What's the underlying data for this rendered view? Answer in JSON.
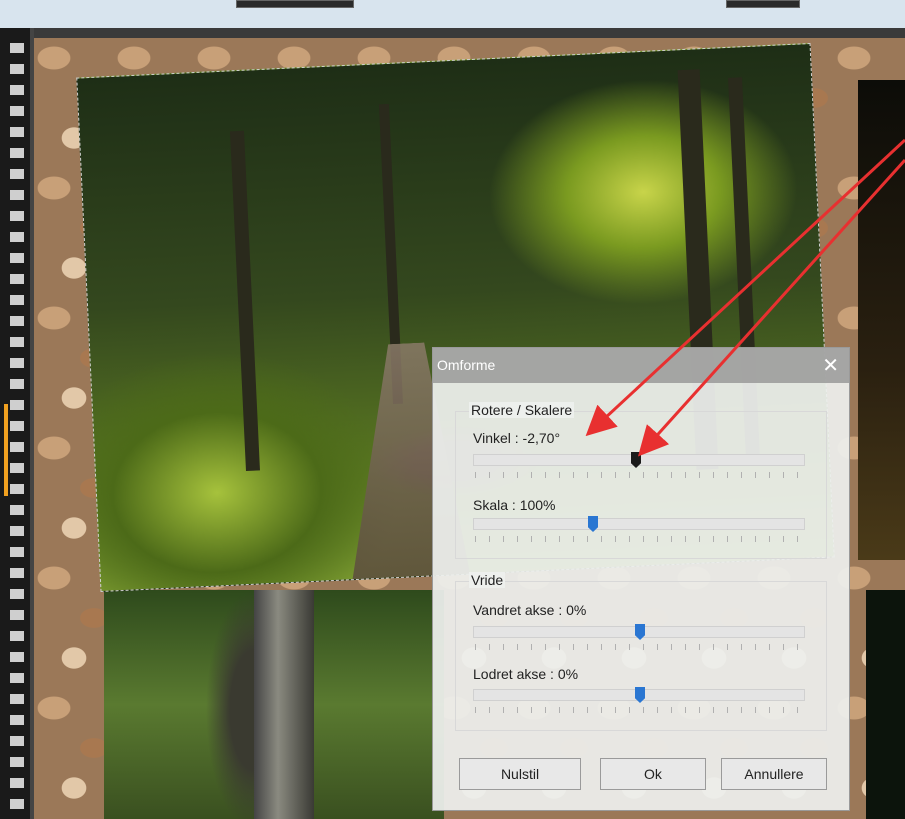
{
  "dialog": {
    "title": "Omforme",
    "close_icon": "close-icon",
    "groups": {
      "rotate_scale": {
        "label": "Rotere / Skalere",
        "angle_label": "Vinkel : -2,70°",
        "angle_value": -2.7,
        "scale_label": "Skala : 100%",
        "scale_value": 100
      },
      "distort": {
        "label": "Vride",
        "horizontal_label": "Vandret akse : 0%",
        "horizontal_value": 0,
        "vertical_label": "Lodret akse : 0%",
        "vertical_value": 0
      }
    },
    "buttons": {
      "reset": "Nulstil",
      "ok": "Ok",
      "cancel": "Annullere"
    }
  },
  "annotation": {
    "arrow_color": "#e83030"
  },
  "colors": {
    "slider_active": "#1a1a1a",
    "slider_thumb": "#2a76d2",
    "accent_marker": "#f0a020"
  }
}
